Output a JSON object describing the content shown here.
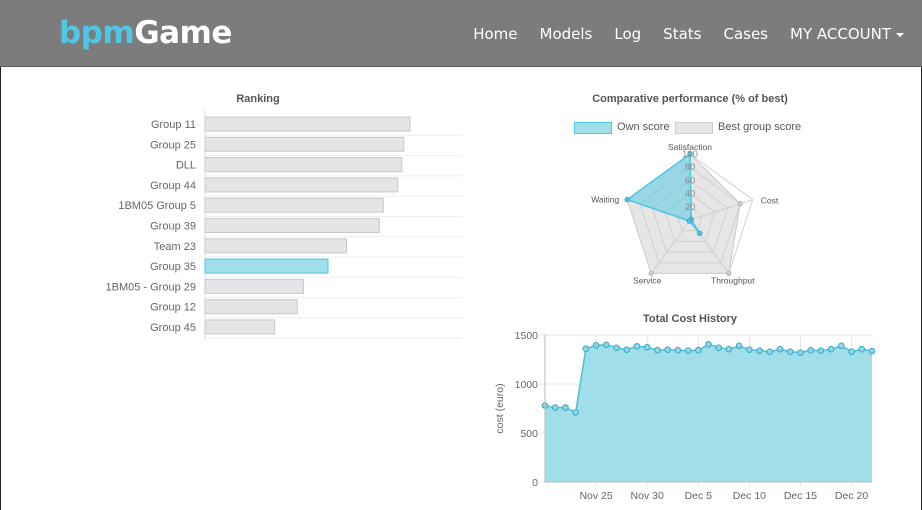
{
  "app": {
    "brand_part1": "bpm",
    "brand_part2": "Game"
  },
  "nav": {
    "items": [
      "Home",
      "Models",
      "Log",
      "Stats",
      "Cases"
    ],
    "account": "MY ACCOUNT"
  },
  "colors": {
    "accent": "#4ec7e5",
    "highlight_fill": "#a0deea",
    "bar_fill": "#e5e5e7",
    "navbar": "#7c7c7c"
  },
  "chart_data": [
    {
      "type": "bar",
      "orientation": "horizontal",
      "title": "Ranking",
      "categories": [
        "Group 11",
        "Group 25",
        "DLL",
        "Group 44",
        "1BM05 Group 5",
        "Group 39",
        "Team 23",
        "Group 35",
        "1BM05 - Group 29",
        "Group 12",
        "Group 45"
      ],
      "values": [
        100,
        97,
        96,
        94,
        87,
        85,
        69,
        60,
        48,
        45,
        34
      ],
      "highlighted": "Group 35"
    },
    {
      "type": "radar",
      "title": "Comparative performance (% of best)",
      "legend": [
        "Own score",
        "Best group score"
      ],
      "axes": [
        "Satisfaction",
        "Cost",
        "Throughput",
        "Service",
        "Waiting"
      ],
      "ticks": [
        20,
        40,
        60,
        80,
        100
      ],
      "series": [
        {
          "name": "Own score",
          "values": [
            100,
            2,
            25,
            2,
            100
          ]
        },
        {
          "name": "Best group score",
          "values": [
            100,
            80,
            100,
            100,
            100
          ]
        }
      ],
      "range": [
        0,
        100
      ]
    },
    {
      "type": "area",
      "title": "Total Cost History",
      "ylabel": "cost (euro)",
      "ylim": [
        0,
        1500
      ],
      "yticks": [
        0,
        500,
        1000,
        1500
      ],
      "xticks": [
        "Nov 25",
        "Nov 30",
        "Dec 5",
        "Dec 10",
        "Dec 15",
        "Dec 20"
      ],
      "x_days": [
        0,
        1,
        2,
        3,
        4,
        5,
        6,
        7,
        8,
        9,
        10,
        11,
        12,
        13,
        14,
        15,
        16,
        17,
        18,
        19,
        20,
        21,
        22,
        23,
        24,
        25,
        26,
        27,
        28,
        29,
        30,
        31,
        32
      ],
      "values": [
        780,
        760,
        760,
        710,
        1360,
        1395,
        1400,
        1370,
        1350,
        1385,
        1375,
        1345,
        1350,
        1345,
        1340,
        1345,
        1405,
        1370,
        1355,
        1390,
        1350,
        1340,
        1330,
        1355,
        1330,
        1320,
        1345,
        1340,
        1355,
        1390,
        1330,
        1355,
        1335
      ]
    }
  ]
}
